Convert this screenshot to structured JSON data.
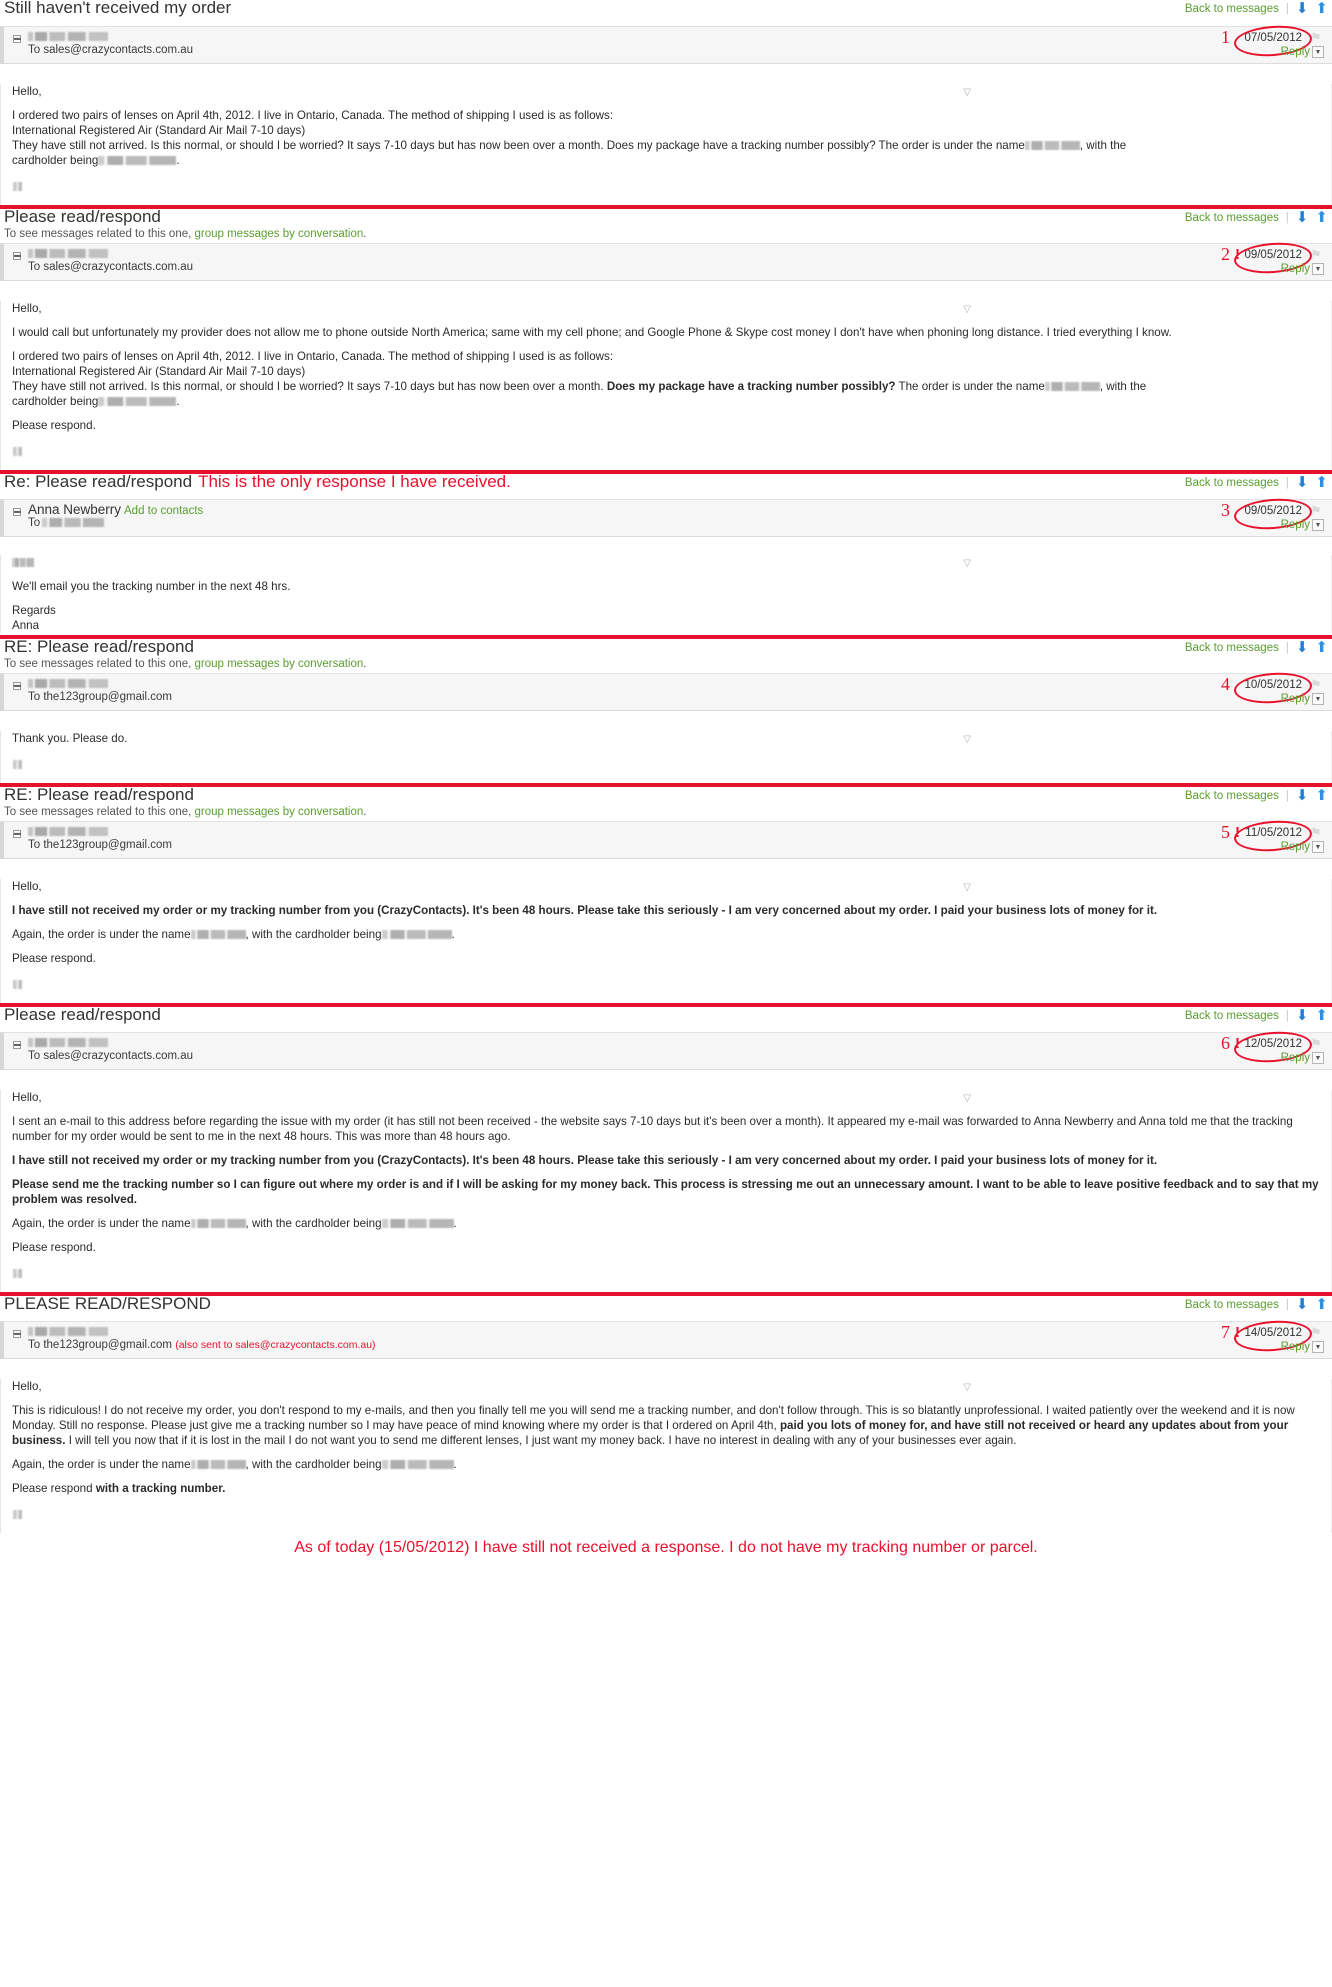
{
  "toolbar": {
    "back_label": "Back to messages",
    "separator": "|",
    "down_arrow_icon": "arrow-down-icon",
    "up_arrow_icon": "arrow-up-icon",
    "reply_label": "Reply",
    "caret": "▼",
    "flag_icon": "flag-icon",
    "expander": "−",
    "collapse_caret": "▽",
    "conversation_prefix": "To see messages related to this one, ",
    "conversation_link": "group messages by conversation",
    "conversation_suffix": ".",
    "add_to_contacts": "Add to contacts"
  },
  "annotations": {
    "response_note": "This is the only response I have received.",
    "bottom_note": "As of today (15/05/2012) I have still not received a response. I do not have my tracking number or parcel.",
    "accent_color": "#e8112d",
    "link_color": "#5a9e2f",
    "icon_color": "#1f7fd4"
  },
  "messages": [
    {
      "index": "1",
      "subject": "Still haven't received my order",
      "has_conversation_line": false,
      "urgent": false,
      "date": "07/05/2012",
      "to": "To sales@crazycontacts.com.au",
      "sender_redacted": true,
      "sender_name": "",
      "body": [
        {
          "text": "Hello,",
          "bold": false
        },
        {
          "text": "I ordered two pairs of lenses on April 4th, 2012. I live in Ontario, Canada. The method of shipping I used is as follows:",
          "bold": false,
          "lines": [
            "I ordered two pairs of lenses on April 4th, 2012. I live in Ontario, Canada. The method of shipping I used is as follows:",
            "International Registered Air (Standard Air Mail 7-10 days)",
            "They have still not arrived. Is this normal, or should I be worried? It says 7-10 days but has now been over a month. Does my package have a tracking number possibly? The order is under the name ▮▮▮, with the cardholder being ▮▮▮."
          ]
        }
      ]
    },
    {
      "index": "2",
      "subject": "Please read/respond",
      "has_conversation_line": true,
      "urgent": true,
      "date": "09/05/2012",
      "to": "To sales@crazycontacts.com.au",
      "sender_redacted": true,
      "sender_name": ""
    },
    {
      "index": "3",
      "subject": "Re: Please read/respond",
      "subject_annotation": "This is the only response I have received.",
      "has_conversation_line": false,
      "urgent": false,
      "date": "09/05/2012",
      "to": "To",
      "sender_redacted": false,
      "sender_name": "Anna Newberry",
      "body_line_1": "We'll email you the tracking number in the next 48 hrs.",
      "body_line_2": "Regards",
      "body_line_3": "Anna"
    },
    {
      "index": "4",
      "subject": "RE: Please read/respond",
      "has_conversation_line": true,
      "urgent": false,
      "date": "10/05/2012",
      "to": "To the123group@gmail.com",
      "sender_redacted": true,
      "sender_name": "",
      "body_line_1": "Thank you. Please do."
    },
    {
      "index": "5",
      "subject": "RE: Please read/respond",
      "has_conversation_line": true,
      "urgent": true,
      "date": "11/05/2012",
      "to": "To the123group@gmail.com",
      "sender_redacted": true,
      "sender_name": ""
    },
    {
      "index": "6",
      "subject": "Please read/respond",
      "has_conversation_line": false,
      "urgent": true,
      "date": "12/05/2012",
      "to": "To sales@crazycontacts.com.au",
      "sender_redacted": true,
      "sender_name": ""
    },
    {
      "index": "7",
      "subject": "PLEASE READ/RESPOND",
      "has_conversation_line": false,
      "urgent": true,
      "date": "14/05/2012",
      "to": "To the123group@gmail.com",
      "to_also": "(also sent to sales@crazycontacts.com.au)",
      "sender_redacted": true,
      "sender_name": ""
    }
  ],
  "bodies": {
    "m1": {
      "hello": "Hello,",
      "l1": "I ordered two pairs of lenses on April 4th, 2012. I live in Ontario, Canada. The method of shipping I used is as follows:",
      "l2": "International Registered Air (Standard Air Mail 7-10 days)",
      "l3a": "They have still not arrived. Is this normal, or should I be worried? It says 7-10 days but has now been over a month. Does my package have a tracking number possibly? The order is under the name",
      "l3b": ", with the",
      "l4a": "cardholder being",
      "l4b": "."
    },
    "m2": {
      "hello": "Hello,",
      "p1": "I would call but unfortunately my provider does not allow me to phone outside North America; same with my cell phone; and Google Phone & Skype cost money I don't have when phoning long distance. I tried everything I know.",
      "l1": "I ordered two pairs of lenses on April 4th, 2012. I live in Ontario, Canada. The method of shipping I used is as follows:",
      "l2": "International Registered Air (Standard Air Mail 7-10 days)",
      "l3a": "They have still not arrived. Is this normal, or should I be worried? It says 7-10 days but has now been over a month.",
      "l3bold": "Does my package have a tracking number possibly?",
      "l3c": "The order is under the name",
      "l3d": ", with the",
      "l4a": "cardholder being",
      "l4b": ".",
      "p3": "Please respond."
    },
    "m3": {
      "greet_redacted": true,
      "p1": "We'll email you the tracking number in the next 48 hrs.",
      "p2": "Regards",
      "p3": "Anna"
    },
    "m4": {
      "p1": "Thank you. Please do."
    },
    "m5": {
      "hello": "Hello,",
      "p1bold": "I have still not received my order or my tracking number from you (CrazyContacts). It's been 48 hours. Please take this seriously - I am very concerned about my order. I paid your business lots of money for it.",
      "p2a": "Again, the order is under the name",
      "p2b": ", with the cardholder being",
      "p2c": ".",
      "p3": "Please respond."
    },
    "m6": {
      "hello": "Hello,",
      "p1": "I sent an e-mail to this address before regarding the issue with my order (it has still not been received - the website says 7-10 days but it's been over a month). It appeared my e-mail was forwarded to Anna Newberry and Anna told me that the tracking number for my order would be sent to me in the next 48 hours. This was more than 48 hours ago.",
      "p2bold": "I have still not received my order or my tracking number from you (CrazyContacts). It's been 48 hours. Please take this seriously - I am very concerned about my order. I paid your business lots of money for it.",
      "p3bold": "Please send me the tracking number so I can figure out where my order is and if I will be asking for my money back. This process is stressing me out an unnecessary amount. I want to be able to leave positive feedback and to say that my problem was resolved.",
      "p4a": "Again, the order is under the name",
      "p4b": ", with the cardholder being",
      "p4c": ".",
      "p5": "Please respond."
    },
    "m7": {
      "hello": "Hello,",
      "p1a": "This is ridiculous! I do not receive my order, you don't respond to my e-mails, and then you finally tell me you will send me a tracking number, and don't follow through. This is so blatantly unprofessional. I waited patiently over the weekend and it is now Monday. Still no response. Please just give me a tracking number so I may have peace of mind knowing where my order is that I ordered on April 4th,",
      "p1bold": "paid you lots of money for, and have still not received or heard any updates about from your business.",
      "p1b": "I will tell you now that if it is lost in the mail I do not want you to send me different lenses, I just want my money back. I have no interest in dealing with any of your businesses ever again.",
      "p2a": "Again, the order is under the name",
      "p2b": ", with the cardholder being",
      "p2c": ".",
      "p3a": "Please respond",
      "p3bold": "with a tracking number."
    }
  }
}
